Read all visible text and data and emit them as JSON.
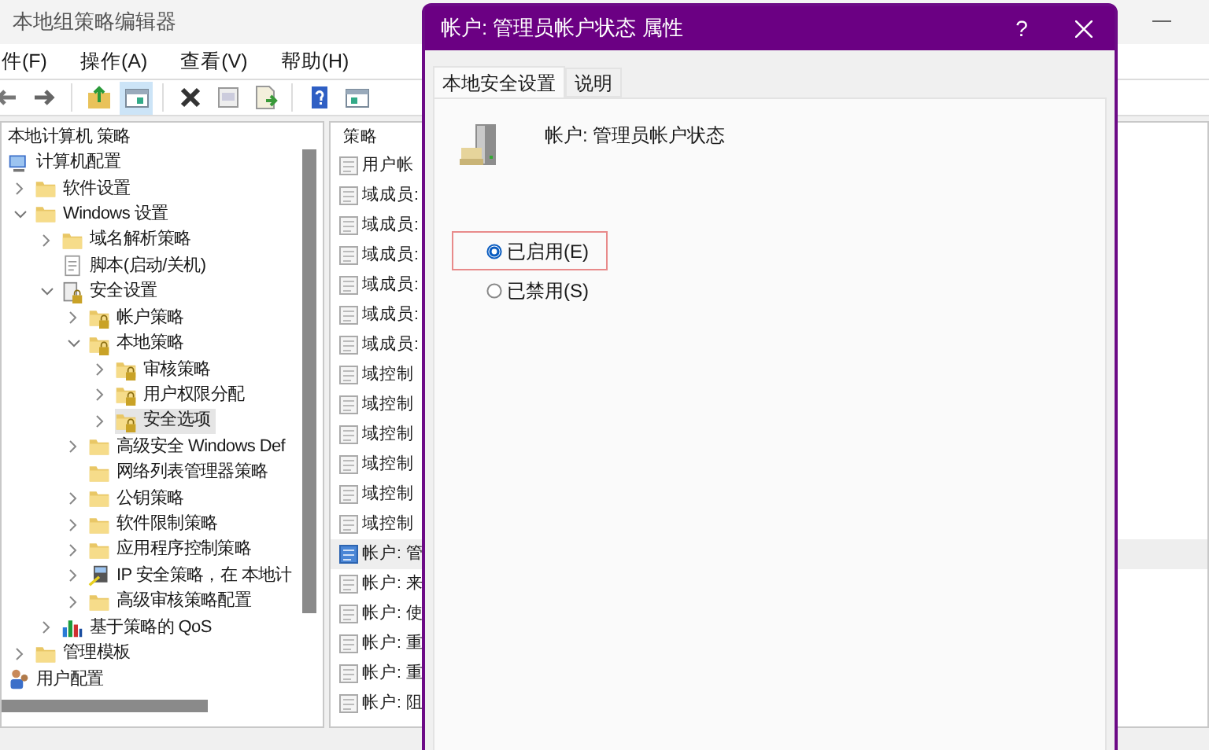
{
  "window": {
    "title": "本地组策略编辑器"
  },
  "menu": [
    "件(F)",
    "操作(A)",
    "查看(V)",
    "帮助(H)"
  ],
  "toolbar": [
    {
      "kind": "back",
      "pressed": false
    },
    {
      "kind": "forward",
      "pressed": false
    },
    {
      "kind": "up",
      "pressed": false
    },
    {
      "kind": "tree",
      "pressed": true
    },
    {
      "kind": "delete",
      "pressed": false
    },
    {
      "kind": "properties",
      "pressed": false
    },
    {
      "kind": "export",
      "pressed": false
    },
    {
      "kind": "help",
      "pressed": false
    },
    {
      "kind": "view",
      "pressed": false
    }
  ],
  "tree": {
    "header": "本地计算机 策略",
    "items": [
      {
        "label": "计算机配置",
        "kind": "computer",
        "selected": false,
        "children": [
          {
            "label": "软件设置",
            "kind": "folder",
            "expanded": false,
            "selected": false
          },
          {
            "label": "Windows 设置",
            "kind": "folder",
            "expanded": true,
            "selected": false,
            "children": [
              {
                "label": "域名解析策略",
                "kind": "folder",
                "expanded": false,
                "selected": false
              },
              {
                "label": "脚本(启动/关机)",
                "kind": "script",
                "selected": false
              },
              {
                "label": "安全设置",
                "kind": "security",
                "expanded": true,
                "selected": false,
                "children": [
                  {
                    "label": "帐户策略",
                    "kind": "lockfolder",
                    "expanded": false,
                    "selected": false
                  },
                  {
                    "label": "本地策略",
                    "kind": "lockfolder",
                    "expanded": true,
                    "selected": false,
                    "children": [
                      {
                        "label": "审核策略",
                        "kind": "lockfolder",
                        "expanded": false,
                        "selected": false
                      },
                      {
                        "label": "用户权限分配",
                        "kind": "lockfolder",
                        "expanded": false,
                        "selected": false
                      },
                      {
                        "label": "安全选项",
                        "kind": "lockfolder",
                        "expanded": false,
                        "selected": true
                      }
                    ]
                  },
                  {
                    "label": "高级安全 Windows Def",
                    "kind": "folder",
                    "expanded": false,
                    "selected": false
                  },
                  {
                    "label": "网络列表管理器策略",
                    "kind": "folder",
                    "selected": false
                  },
                  {
                    "label": "公钥策略",
                    "kind": "folder",
                    "expanded": false,
                    "selected": false
                  },
                  {
                    "label": "软件限制策略",
                    "kind": "folder",
                    "expanded": false,
                    "selected": false
                  },
                  {
                    "label": "应用程序控制策略",
                    "kind": "folder",
                    "expanded": false,
                    "selected": false
                  },
                  {
                    "label": "IP 安全策略，在 本地计",
                    "kind": "ip",
                    "expanded": false,
                    "selected": false
                  },
                  {
                    "label": "高级审核策略配置",
                    "kind": "folder",
                    "expanded": false,
                    "selected": false
                  }
                ]
              },
              {
                "label": "基于策略的 QoS",
                "kind": "chart",
                "expanded": false,
                "selected": false
              }
            ]
          },
          {
            "label": "管理模板",
            "kind": "folder",
            "expanded": false,
            "selected": false
          }
        ]
      },
      {
        "label": "用户配置",
        "kind": "user",
        "selected": false
      }
    ]
  },
  "list": {
    "header": "策略",
    "rows": [
      {
        "text": "用户帐",
        "selected": false
      },
      {
        "text": "域成员:",
        "selected": false
      },
      {
        "text": "域成员:",
        "selected": false
      },
      {
        "text": "域成员:",
        "selected": false
      },
      {
        "text": "域成员:",
        "selected": false
      },
      {
        "text": "域成员:",
        "selected": false
      },
      {
        "text": "域成员:",
        "selected": false
      },
      {
        "text": "域控制",
        "selected": false
      },
      {
        "text": "域控制",
        "selected": false
      },
      {
        "text": "域控制",
        "selected": false
      },
      {
        "text": "域控制",
        "selected": false
      },
      {
        "text": "域控制",
        "selected": false
      },
      {
        "text": "域控制",
        "selected": false
      },
      {
        "text": "帐户: 管",
        "selected": true
      },
      {
        "text": "帐户: 来",
        "selected": false
      },
      {
        "text": "帐户: 使",
        "selected": false
      },
      {
        "text": "帐户: 重",
        "selected": false
      },
      {
        "text": "帐户: 重",
        "selected": false
      },
      {
        "text": "帐户: 阻",
        "selected": false
      }
    ]
  },
  "dialog": {
    "title": "帐户: 管理员帐户状态 属性",
    "help": "?",
    "tabs": [
      {
        "label": "本地安全设置",
        "selected": true
      },
      {
        "label": "说明",
        "selected": false
      }
    ],
    "setting": "帐户: 管理员帐户状态",
    "options": [
      {
        "label": "已启用(E)",
        "selected": true,
        "focused": true
      },
      {
        "label": "已禁用(S)",
        "selected": false,
        "focused": false
      }
    ]
  }
}
